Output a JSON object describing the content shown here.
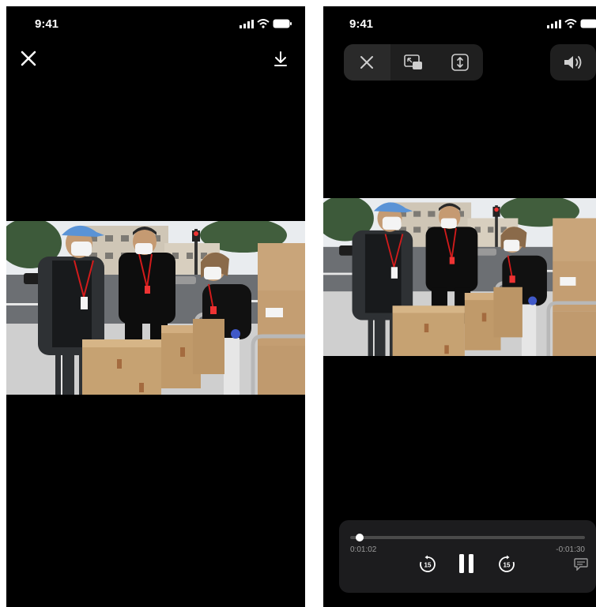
{
  "left_screen": {
    "status_time": "9:41",
    "icons": [
      "signal-icon",
      "wifi-icon",
      "battery-icon",
      "close-icon",
      "download-icon"
    ]
  },
  "right_screen": {
    "status_time": "9:41",
    "toolbar_icons": [
      "close-icon",
      "picture-in-picture-icon",
      "fit-screen-icon",
      "volume-icon"
    ],
    "player": {
      "current_time": "0:01:02",
      "remaining_time": "-0:01:30",
      "progress": 0.04,
      "skip_back_seconds": "15",
      "skip_forward_seconds": "15",
      "state": "playing",
      "icons": [
        "skip-back-15-icon",
        "pause-icon",
        "skip-forward-15-icon",
        "captions-icon"
      ]
    }
  },
  "colors": {
    "background": "#000000",
    "panel": "#1c1c1e",
    "track": "#4a4a4a",
    "text": "#ffffff",
    "muted": "#9a9a9a"
  }
}
